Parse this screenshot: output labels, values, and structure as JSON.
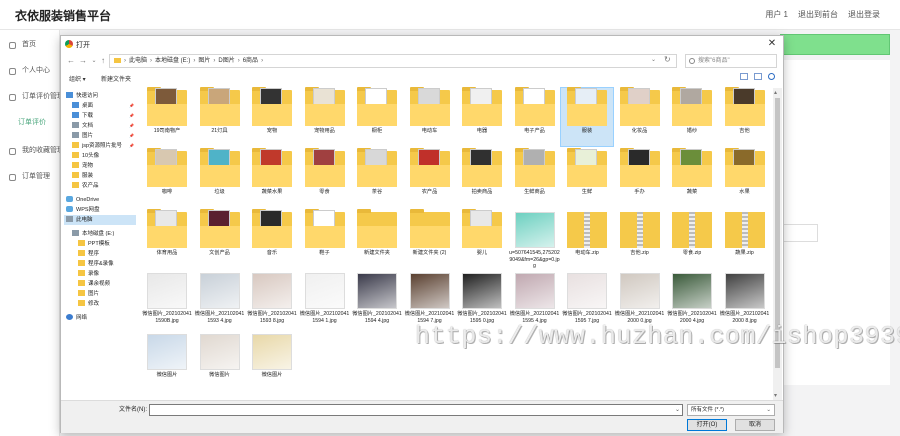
{
  "app": {
    "brand": "衣依服装销售平台",
    "topnav": [
      "用户 1",
      "退出到前台",
      "退出登录"
    ],
    "sidebar": [
      {
        "label": "首页",
        "active": false
      },
      {
        "label": "个人中心",
        "active": false
      },
      {
        "label": "订单评价管理",
        "active": false
      },
      {
        "label": "订单评价",
        "active": true
      },
      {
        "label": "我的收藏管理",
        "active": false
      },
      {
        "label": "订单管理",
        "active": false
      }
    ]
  },
  "dialog": {
    "title": "打开",
    "close": "✕",
    "breadcrumb": [
      "此电脑",
      "本地磁盘 (E:)",
      "图片",
      "D图片",
      "6商品"
    ],
    "search_placeholder": "搜索\"6商品\"",
    "organize": "组织 ▾",
    "new_folder": "新建文件夹",
    "tree": [
      {
        "label": "快速访问",
        "icon": "b",
        "pin": false
      },
      {
        "label": "桌面",
        "icon": "b",
        "pin": true
      },
      {
        "label": "下载",
        "icon": "b",
        "pin": true
      },
      {
        "label": "文档",
        "icon": "g",
        "pin": true
      },
      {
        "label": "图片",
        "icon": "g",
        "pin": true
      },
      {
        "label": "jsp资源照片批号",
        "icon": "f",
        "pin": true
      },
      {
        "label": "10头像",
        "icon": "f",
        "pin": false
      },
      {
        "label": "宠物",
        "icon": "f",
        "pin": false
      },
      {
        "label": "服装",
        "icon": "f",
        "pin": false
      },
      {
        "label": "农产品",
        "icon": "f",
        "pin": false
      },
      {
        "label": "OneDrive",
        "icon": "c",
        "pin": false
      },
      {
        "label": "WPS网盘",
        "icon": "c",
        "pin": false
      },
      {
        "label": "此电脑",
        "icon": "g",
        "pin": false,
        "selected": true
      },
      {
        "label": "本地磁盘 (E:)",
        "icon": "g",
        "pin": false
      },
      {
        "label": "PPT模板",
        "icon": "f",
        "pin": false
      },
      {
        "label": "程序",
        "icon": "f",
        "pin": false
      },
      {
        "label": "程序&录像",
        "icon": "f",
        "pin": false
      },
      {
        "label": "录像",
        "icon": "f",
        "pin": false
      },
      {
        "label": "课余视频",
        "icon": "f",
        "pin": false
      },
      {
        "label": "图片",
        "icon": "f",
        "pin": false
      },
      {
        "label": "修改",
        "icon": "f",
        "pin": false
      },
      {
        "label": "网络",
        "icon": "n",
        "pin": false
      }
    ],
    "files": [
      {
        "name": "19司南物产",
        "kind": "folder",
        "c": "#7d5a3a"
      },
      {
        "name": "21灯具",
        "kind": "folder",
        "c": "#c9a67a"
      },
      {
        "name": "宠物",
        "kind": "folder",
        "c": "#333333"
      },
      {
        "name": "宠物用品",
        "kind": "folder",
        "c": "#e9e2d4"
      },
      {
        "name": "橱柜",
        "kind": "folder",
        "c": "#ffffff"
      },
      {
        "name": "电动车",
        "kind": "folder",
        "c": "#d9d9d9"
      },
      {
        "name": "电器",
        "kind": "folder",
        "c": "#f0f0f0"
      },
      {
        "name": "电子产品",
        "kind": "folder",
        "c": "#ffffff"
      },
      {
        "name": "服装",
        "kind": "folder",
        "c": "#e6eef6",
        "selected": true
      },
      {
        "name": "化妆品",
        "kind": "folder",
        "c": "#e0d0c8"
      },
      {
        "name": "婚纱",
        "kind": "folder",
        "c": "#b0a8a0"
      },
      {
        "name": "吉他",
        "kind": "folder",
        "c": "#4a3a2a"
      },
      {
        "name": "咖啡",
        "kind": "folder",
        "c": "#d8c8b0"
      },
      {
        "name": "垃圾",
        "kind": "folder",
        "c": "#4fb3c8"
      },
      {
        "name": "蔬菜水果",
        "kind": "folder",
        "c": "#c0392b"
      },
      {
        "name": "零食",
        "kind": "folder",
        "c": "#a04040"
      },
      {
        "name": "茶谷",
        "kind": "folder",
        "c": "#d8d8d8"
      },
      {
        "name": "农产品",
        "kind": "folder",
        "c": "#c0302a"
      },
      {
        "name": "拍卖商品",
        "kind": "folder",
        "c": "#303030"
      },
      {
        "name": "生鲜商品",
        "kind": "folder",
        "c": "#b0b0b0"
      },
      {
        "name": "生鲜",
        "kind": "folder",
        "c": "#e8f0d8"
      },
      {
        "name": "手办",
        "kind": "folder",
        "c": "#2a2a2a"
      },
      {
        "name": "蔬菜",
        "kind": "folder",
        "c": "#6b8e3a"
      },
      {
        "name": "水果",
        "kind": "folder",
        "c": "#8a6a2a"
      },
      {
        "name": "体育用品",
        "kind": "folder",
        "c": "#e8e8e8"
      },
      {
        "name": "文创产品",
        "kind": "folder",
        "c": "#5a2030"
      },
      {
        "name": "音乐",
        "kind": "folder",
        "c": "#2a2a2a"
      },
      {
        "name": "鞋子",
        "kind": "folder",
        "c": "#ffffff"
      },
      {
        "name": "新建文件夹",
        "kind": "folder",
        "c": ""
      },
      {
        "name": "新建文件夹 (2)",
        "kind": "folder",
        "c": ""
      },
      {
        "name": "婴儿",
        "kind": "folder",
        "c": "#e8e8e8"
      },
      {
        "name": "u=507641545,2752029049&fm=26&gp=0.jpg",
        "kind": "photo",
        "c": "#6dd0c0"
      },
      {
        "name": "电动车.zip",
        "kind": "zip",
        "c": ""
      },
      {
        "name": "吉他.zip",
        "kind": "zip",
        "c": ""
      },
      {
        "name": "零食.zip",
        "kind": "zip",
        "c": ""
      },
      {
        "name": "蔬果.zip",
        "kind": "zip",
        "c": ""
      },
      {
        "name": "微信图片_2021020411590B.jpg",
        "kind": "photo",
        "c": "#e8e8e8"
      },
      {
        "name": "微信图片_2021020411593 4.jpg",
        "kind": "photo",
        "c": "#c8d0d8"
      },
      {
        "name": "微信图片_2021020411593 8.jpg",
        "kind": "photo",
        "c": "#d8c8c0"
      },
      {
        "name": "微信图片_2021020411594 1.jpg",
        "kind": "photo",
        "c": "#f0f0f0"
      },
      {
        "name": "微信图片_2021020411594 4.jpg",
        "kind": "photo",
        "c": "#3a3a4a"
      },
      {
        "name": "微信图片_2021020411594 7.jpg",
        "kind": "photo",
        "c": "#5a4030"
      },
      {
        "name": "微信图片_2021020411595 0.jpg",
        "kind": "photo",
        "c": "#202020"
      },
      {
        "name": "微信图片_2021020411595 4.jpg",
        "kind": "photo",
        "c": "#c0a8b0"
      },
      {
        "name": "微信图片_2021020411595 7.jpg",
        "kind": "photo",
        "c": "#e8e0e0"
      },
      {
        "name": "微信图片_2021020412000 0.jpg",
        "kind": "photo",
        "c": "#d0c8c0"
      },
      {
        "name": "微信图片_2021020412000 4.jpg",
        "kind": "photo",
        "c": "#3a5a3a"
      },
      {
        "name": "微信图片_2021020412000 8.jpg",
        "kind": "photo",
        "c": "#404040"
      },
      {
        "name": "微信图片",
        "kind": "photo",
        "c": "#c8d8e8"
      },
      {
        "name": "微信图片",
        "kind": "photo",
        "c": "#e0d8d0"
      },
      {
        "name": "微信图片",
        "kind": "photo",
        "c": "#e8d8a8"
      }
    ],
    "filename_label": "文件名(N):",
    "filetype": "所有文件 (*.*)",
    "open_button": "打开(O)",
    "cancel_button": "取消"
  },
  "watermark": "https://www.huzhan.com/ishop39397"
}
